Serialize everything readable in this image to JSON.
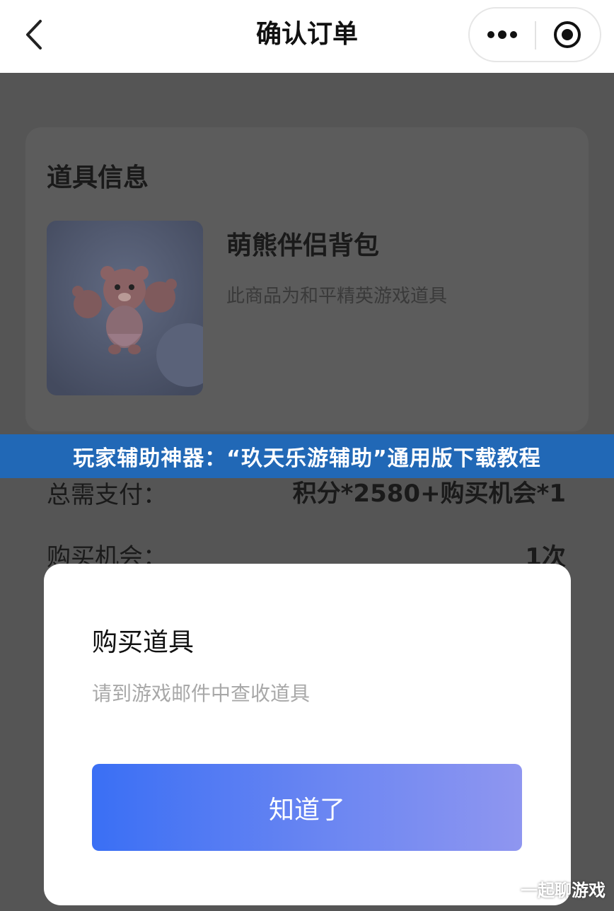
{
  "navbar": {
    "title": "确认订单",
    "back_icon": "chevron-left-icon",
    "more_icon": "more-dots-icon",
    "target_icon": "target-icon"
  },
  "item_info": {
    "section_title": "道具信息",
    "product_name": "萌熊伴侣背包",
    "product_desc": "此商品为和平精英游戏道具"
  },
  "payment": {
    "total_label": "总需支付：",
    "total_value": "积分*2580+购买机会*1",
    "chance_label": "购买机会：",
    "chance_value": "1次"
  },
  "banner": {
    "text": "玩家辅助神器：“玖天乐游辅助”通用版下载教程",
    "color": "#2168b6"
  },
  "dialog": {
    "title": "购买道具",
    "message": "请到游戏邮件中查收道具",
    "confirm_label": "知道了",
    "button_color_start": "#3a6ff4",
    "button_color_end": "#8f96f0"
  },
  "watermark": {
    "text": "一起聊游戏"
  }
}
